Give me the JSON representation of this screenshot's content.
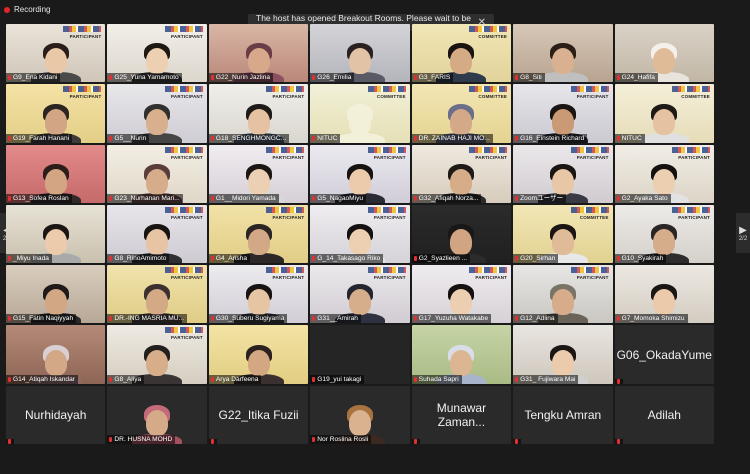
{
  "recording": {
    "label": "Recording"
  },
  "notice": {
    "text": "The host has opened Breakout Rooms. Please wait to be assigned.",
    "close": "✕"
  },
  "pager": {
    "left_page": "2/2",
    "right_page": "2/2",
    "left_arrow": "◀",
    "right_arrow": "▶"
  },
  "tiles": [
    {
      "name": "G9_Ena Kidani",
      "kind": "video",
      "bg1": "#e9e3d9",
      "bg2": "#cfc6b8",
      "skin": "#e9c8a8",
      "hair": "#2a1f18",
      "shirt": "#4a4a4a",
      "tag": "PARTICIPANT"
    },
    {
      "name": "G25_Yuna Yamamoto",
      "kind": "video",
      "bg1": "#f2efe9",
      "bg2": "#dcd6cc",
      "skin": "#edcfb1",
      "hair": "#1f1712",
      "shirt": "#3a3a3a",
      "tag": "PARTICIPANT"
    },
    {
      "name": "G22_Nurin Jazlina",
      "kind": "video",
      "bg1": "#d9b7a6",
      "bg2": "#b9877a",
      "skin": "#d7a98a",
      "hair": "#6a3c45",
      "shirt": "#8a5060",
      "tag": ""
    },
    {
      "name": "G26_Emilia",
      "kind": "video",
      "bg1": "#d4d4d8",
      "bg2": "#b4b4bc",
      "skin": "#e2c3a6",
      "hair": "#2a2220",
      "shirt": "#5a5a66",
      "tag": ""
    },
    {
      "name": "G3_FARIS",
      "kind": "video",
      "bg1": "#f1e6b6",
      "bg2": "#e2d39a",
      "skin": "#d5ab86",
      "hair": "#1a1410",
      "shirt": "#2f3a4a",
      "tag": "COMMITTEE"
    },
    {
      "name": "G8_Siti",
      "kind": "video",
      "bg1": "#d7c8b8",
      "bg2": "#b8a390",
      "skin": "#d9b191",
      "hair": "#2c1f17",
      "shirt": "#bfbfbf",
      "tag": ""
    },
    {
      "name": "G24_Hafifa",
      "kind": "video",
      "bg1": "#d9d2c6",
      "bg2": "#c2b7a6",
      "skin": "#e0bb98",
      "hair": "#f4f1ea",
      "shirt": "#e8e4dc",
      "tag": ""
    },
    {
      "name": "G19_Farah Hanani",
      "kind": "video",
      "bg1": "#f4e2a6",
      "bg2": "#e3cf86",
      "skin": "#d2a684",
      "hair": "#2b2420",
      "shirt": "#3f3a3a",
      "tag": "PARTICIPANT"
    },
    {
      "name": "G5__Nurin",
      "kind": "video",
      "bg1": "#e8e7ea",
      "bg2": "#cfcdd4",
      "skin": "#d9b08e",
      "hair": "#30302e",
      "shirt": "#454545",
      "tag": "PARTICIPANT"
    },
    {
      "name": "G18_SENGHMONGC...",
      "kind": "video",
      "bg1": "#f0efe9",
      "bg2": "#d9d6cf",
      "skin": "#e5c3a2",
      "hair": "#1e1a18",
      "shirt": "#4c5a6a",
      "tag": "PARTICIPANT"
    },
    {
      "name": "NITUC",
      "kind": "video",
      "bg1": "#f2f0d8",
      "bg2": "#e5e0b6",
      "skin": "#f2f0d8",
      "hair": "#f2f0d8",
      "shirt": "#f2f0d8",
      "tag": "COMMITTEE"
    },
    {
      "name": "DR. ZAINAB HAJI MO...",
      "kind": "video",
      "bg1": "#f3e6b4",
      "bg2": "#e4d391",
      "skin": "#d3a988",
      "hair": "#6a6e88",
      "shirt": "#5a6077",
      "tag": "COMMITTEE"
    },
    {
      "name": "G16_Einstein Richard",
      "kind": "video",
      "bg1": "#e7e6ea",
      "bg2": "#cbc9d1",
      "skin": "#c99a74",
      "hair": "#1a1512",
      "shirt": "#2a2a35",
      "tag": "PARTICIPANT"
    },
    {
      "name": "NITUC",
      "kind": "video",
      "bg1": "#f4efd9",
      "bg2": "#e6dcb8",
      "skin": "#e6c3a0",
      "hair": "#1e1a18",
      "shirt": "#e0e0e0",
      "tag": "COMMITTEE"
    },
    {
      "name": "G13_Sofea Roslan",
      "kind": "video",
      "bg1": "#e38a8a",
      "bg2": "#c66a6a",
      "skin": "#d3a583",
      "hair": "#2a1d1a",
      "shirt": "#33292a",
      "tag": ""
    },
    {
      "name": "G23_Nurhanan Mari...",
      "kind": "video",
      "bg1": "#f3eee4",
      "bg2": "#dfd7c8",
      "skin": "#d6ad8b",
      "hair": "#5a3c3a",
      "shirt": "#6a4b4b",
      "tag": "PARTICIPANT"
    },
    {
      "name": "G1__Midori Yamada",
      "kind": "video",
      "bg1": "#f0ecf0",
      "bg2": "#d6d0d6",
      "skin": "#ecd0b4",
      "hair": "#1c1614",
      "shirt": "#d8d8d8",
      "tag": "PARTICIPANT"
    },
    {
      "name": "G5_NagaoMiyu",
      "kind": "video",
      "bg1": "#eceaf0",
      "bg2": "#d0cdd8",
      "skin": "#ebcbac",
      "hair": "#161212",
      "shirt": "#2b2b33",
      "tag": "PARTICIPANT"
    },
    {
      "name": "G32_Afiqah Norza...",
      "kind": "video",
      "bg1": "#efe9e0",
      "bg2": "#d7ccbc",
      "skin": "#d6ac89",
      "hair": "#1e1a18",
      "shirt": "#2c2a2a",
      "tag": "PARTICIPANT"
    },
    {
      "name": "Zoomユーザー",
      "kind": "video",
      "bg1": "#ebe8ea",
      "bg2": "#d0cbd0",
      "skin": "#e8c7a6",
      "hair": "#1a1614",
      "shirt": "#3a3a44",
      "tag": "PARTICIPANT"
    },
    {
      "name": "G2_Ayaka Sato",
      "kind": "video",
      "bg1": "#f1ede6",
      "bg2": "#dcd4c6",
      "skin": "#ecceb1",
      "hair": "#15110f",
      "shirt": "#e2e2e2",
      "tag": "PARTICIPANT"
    },
    {
      "name": "_Miyu Inada",
      "kind": "video",
      "bg1": "#e7e2d6",
      "bg2": "#cac1ae",
      "skin": "#ebcbab",
      "hair": "#1b1614",
      "shirt": "#a9a9a9",
      "tag": ""
    },
    {
      "name": "G8_RinoAmimoto",
      "kind": "video",
      "bg1": "#e8e6ea",
      "bg2": "#cdcad2",
      "skin": "#e7c5a4",
      "hair": "#181412",
      "shirt": "#2f2f36",
      "tag": "PARTICIPANT"
    },
    {
      "name": "G4_Arisha",
      "kind": "video",
      "bg1": "#f1e2a8",
      "bg2": "#e1cd86",
      "skin": "#d3a886",
      "hair": "#2a2522",
      "shirt": "#2c2828",
      "tag": "PARTICIPANT"
    },
    {
      "name": "G_14_Takasago Riko",
      "kind": "video",
      "bg1": "#efedf0",
      "bg2": "#d5d2d8",
      "skin": "#edcfb2",
      "hair": "#141110",
      "shirt": "#e4e4e4",
      "tag": "PARTICIPANT"
    },
    {
      "name": "G2_Syazlieen ...",
      "kind": "video",
      "bg1": "#2b2b2b",
      "bg2": "#202020",
      "skin": "#d1a582",
      "hair": "#1a1717",
      "shirt": "#2b2b2b",
      "tag": ""
    },
    {
      "name": "G20_Sirhan",
      "kind": "video",
      "bg1": "#f2e7b6",
      "bg2": "#e1d191",
      "skin": "#e0bb97",
      "hair": "#1a1512",
      "shirt": "#e8e8e8",
      "tag": "COMMITTEE"
    },
    {
      "name": "G10_Syakirah",
      "kind": "video",
      "bg1": "#edebe8",
      "bg2": "#d4d0ca",
      "skin": "#d6ad8b",
      "hair": "#2a2626",
      "shirt": "#2e2c2c",
      "tag": "PARTICIPANT"
    },
    {
      "name": "G15_Fatin Naqiyyah",
      "kind": "video",
      "bg1": "#d9cdbf",
      "bg2": "#b8a896",
      "skin": "#d2a784",
      "hair": "#1e1a1a",
      "shirt": "#2a2a2a",
      "tag": ""
    },
    {
      "name": "DR.-ING MASRIA MU...",
      "kind": "video",
      "bg1": "#f0e3ac",
      "bg2": "#dfcc86",
      "skin": "#d4a985",
      "hair": "#3a3030",
      "shirt": "#4a3e3e",
      "tag": "PARTICIPANT"
    },
    {
      "name": "G30_Suberu Sugiyama",
      "kind": "video",
      "bg1": "#ecebee",
      "bg2": "#d1ced6",
      "skin": "#e6c5a3",
      "hair": "#171313",
      "shirt": "#3a3a42",
      "tag": "PARTICIPANT"
    },
    {
      "name": "G31__Amirah",
      "kind": "video",
      "bg1": "#ebe9ec",
      "bg2": "#d1ccd2",
      "skin": "#d7ae8c",
      "hair": "#24252e",
      "shirt": "#2f3140",
      "tag": "PARTICIPANT"
    },
    {
      "name": "G17_Yuzuha Watakabe",
      "kind": "video",
      "bg1": "#efecef",
      "bg2": "#d6d1d6",
      "skin": "#ecceb0",
      "hair": "#141110",
      "shirt": "#d8d8d8",
      "tag": "PARTICIPANT"
    },
    {
      "name": "G12_Adlina",
      "kind": "video",
      "bg1": "#e7e6e4",
      "bg2": "#cac7c2",
      "skin": "#d6ac8a",
      "hair": "#7a7468",
      "shirt": "#6a6458",
      "tag": "PARTICIPANT"
    },
    {
      "name": "G7_Momoka Shimizu",
      "kind": "video",
      "bg1": "#ece8e2",
      "bg2": "#d3ccc1",
      "skin": "#ebcaab",
      "hair": "#1a1614",
      "shirt": "#c4c4c4",
      "tag": ""
    },
    {
      "name": "G14_Atiqah Iskandar",
      "kind": "video",
      "bg1": "#b58a78",
      "bg2": "#8e6555",
      "skin": "#d3a886",
      "hair": "#d8d0d2",
      "shirt": "#8c6a6e",
      "tag": ""
    },
    {
      "name": "G8_Aliya",
      "kind": "video",
      "bg1": "#eeeae2",
      "bg2": "#d5cdc0",
      "skin": "#d7ad8a",
      "hair": "#231f1d",
      "shirt": "#3a3434",
      "tag": "PARTICIPANT"
    },
    {
      "name": "Arya Darfeena",
      "kind": "video",
      "bg1": "#f3e4a5",
      "bg2": "#e2ce82",
      "skin": "#d4a783",
      "hair": "#2b2220",
      "shirt": "#3a3030",
      "tag": ""
    },
    {
      "name": "G19_yui takagi",
      "kind": "blank",
      "bg1": "#252525",
      "bg2": "#252525",
      "skin": "#252525",
      "hair": "#252525",
      "shirt": "#252525",
      "tag": ""
    },
    {
      "name": "Suhada Sapri",
      "kind": "video",
      "bg1": "#c6d4a6",
      "bg2": "#a9bb85",
      "skin": "#dcb593",
      "hair": "#d9dde8",
      "shirt": "#a8b4c9",
      "tag": ""
    },
    {
      "name": "G31_ Fujiwara Mai",
      "kind": "video",
      "bg1": "#e9e5e0",
      "bg2": "#cec7bd",
      "skin": "#ebcbac",
      "hair": "#1b1614",
      "shirt": "#d0d0d0",
      "tag": ""
    },
    {
      "name": "G06_OkadaYume",
      "kind": "nameonly",
      "big": true
    },
    {
      "name": "Nurhidayah",
      "kind": "nameonly",
      "big": true
    },
    {
      "name": "DR. HUSNA MOHD",
      "kind": "video",
      "bg1": "#2a2a2a",
      "bg2": "#2a2a2a",
      "skin": "#d5aa88",
      "hair": "#c56a7a",
      "shirt": "#a3505f",
      "tag": ""
    },
    {
      "name": "G22_Itika Fuzii",
      "kind": "nameonly",
      "big": true
    },
    {
      "name": "Nor Roslina Rosli",
      "kind": "video",
      "bg1": "#2a2a2a",
      "bg2": "#2a2a2a",
      "skin": "#d9b28f",
      "hair": "#a8733f",
      "shirt": "#3a2a22",
      "tag": ""
    },
    {
      "name": "Munawar Zaman...",
      "kind": "nameonly",
      "big": true
    },
    {
      "name": "Tengku Amran",
      "kind": "nameonly",
      "big": true
    },
    {
      "name": "Adilah",
      "kind": "nameonly",
      "big": true
    }
  ]
}
